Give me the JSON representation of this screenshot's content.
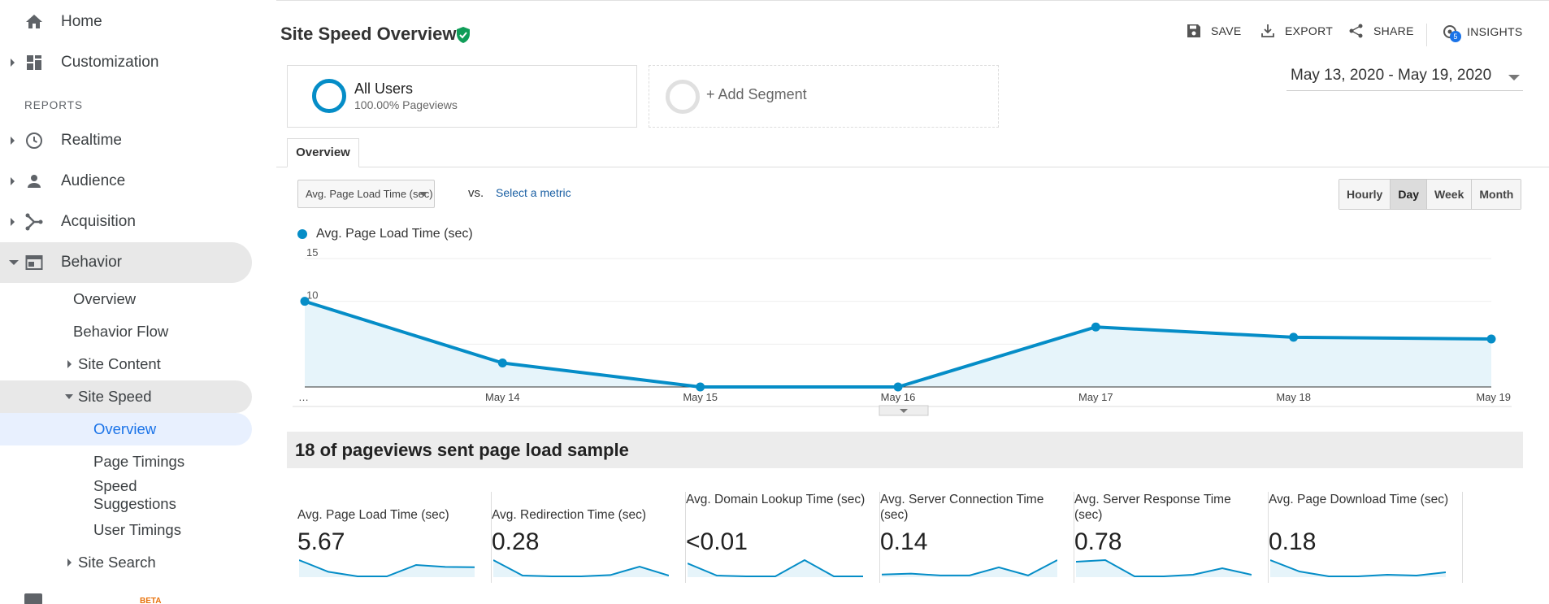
{
  "sidebar": {
    "home": "Home",
    "customization": "Customization",
    "reports_heading": "REPORTS",
    "realtime": "Realtime",
    "audience": "Audience",
    "acquisition": "Acquisition",
    "behavior": "Behavior",
    "behavior_items": {
      "overview": "Overview",
      "behavior_flow": "Behavior Flow",
      "site_content": "Site Content",
      "site_speed": "Site Speed",
      "site_speed_overview": "Overview",
      "page_timings": "Page Timings",
      "speed_suggestions": "Speed Suggestions",
      "user_timings": "User Timings",
      "site_search": "Site Search"
    },
    "partial_item_badge": "BETA"
  },
  "header": {
    "title": "Site Speed Overview",
    "actions": {
      "save": "SAVE",
      "export": "EXPORT",
      "share": "SHARE",
      "insights": "INSIGHTS",
      "insights_badge": "5"
    }
  },
  "segments": {
    "all_users": {
      "name": "All Users",
      "sub": "100.00% Pageviews"
    },
    "add": "+ Add Segment"
  },
  "date_range": "May 13, 2020 - May 19, 2020",
  "tabs": {
    "overview": "Overview"
  },
  "metric": {
    "selected": "Avg. Page Load Time (sec)",
    "vs": "vs.",
    "select_link": "Select a metric"
  },
  "granularity": [
    "Hourly",
    "Day",
    "Week",
    "Month"
  ],
  "granularity_selected": "Day",
  "colors": {
    "accent": "#058dc7",
    "fill": "#e6f4fa",
    "verified": "#0f9d58"
  },
  "chart_data": {
    "type": "area",
    "legend": [
      "Avg. Page Load Time (sec)"
    ],
    "x": [
      "…",
      "May 14",
      "May 15",
      "May 16",
      "May 17",
      "May 18",
      "May 19"
    ],
    "series": [
      {
        "name": "Avg. Page Load Time (sec)",
        "values": [
          10,
          2.8,
          0,
          0,
          7,
          5.8,
          5.6
        ]
      }
    ],
    "y_ticks": [
      5,
      10,
      15
    ],
    "ylim": [
      0,
      15
    ]
  },
  "sample_text": "18 of pageviews sent page load sample",
  "stats": [
    {
      "name": "Avg. Page Load Time (sec)",
      "value": "5.67",
      "spark": [
        10,
        2.8,
        0,
        0,
        7,
        5.8,
        5.6
      ]
    },
    {
      "name": "Avg. Redirection Time (sec)",
      "value": "0.28",
      "spark": [
        1.0,
        0.05,
        0.0,
        0.0,
        0.08,
        0.6,
        0.05
      ]
    },
    {
      "name": "Avg. Domain Lookup Time (sec)",
      "value": "<0.01",
      "spark": [
        0.8,
        0.05,
        0.0,
        0.0,
        1.0,
        0.0,
        0.0
      ]
    },
    {
      "name": "Avg. Server Connection Time (sec)",
      "value": "0.14",
      "spark": [
        0.1,
        0.15,
        0.05,
        0.05,
        0.5,
        0.05,
        0.9
      ]
    },
    {
      "name": "Avg. Server Response Time (sec)",
      "value": "0.78",
      "spark": [
        0.9,
        1.0,
        0.0,
        0.0,
        0.1,
        0.5,
        0.1
      ]
    },
    {
      "name": "Avg. Page Download Time (sec)",
      "value": "0.18",
      "spark": [
        1.0,
        0.3,
        0.0,
        0.0,
        0.1,
        0.05,
        0.25
      ]
    }
  ]
}
